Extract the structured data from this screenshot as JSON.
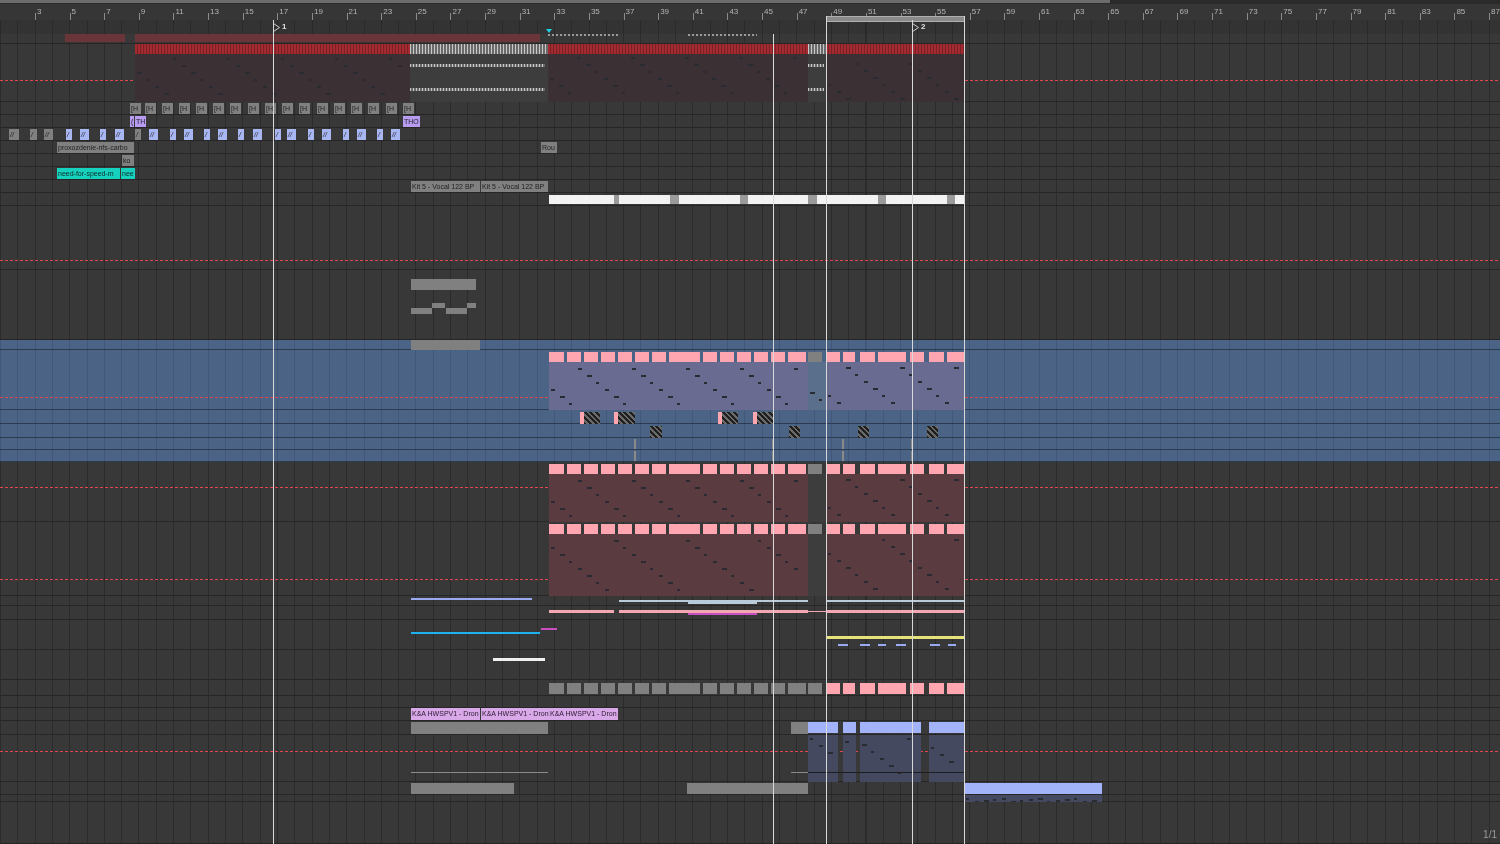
{
  "ruler": {
    "bar_labels": [
      "3",
      "5",
      "7",
      "9",
      "11",
      "13",
      "15",
      "17",
      "19",
      "21",
      "23",
      "25",
      "27",
      "29",
      "31",
      "33",
      "35",
      "37",
      "39",
      "41",
      "43",
      "45",
      "47",
      "49",
      "51",
      "53",
      "55",
      "57",
      "59",
      "61",
      "63",
      "65",
      "67",
      "69",
      "71",
      "73",
      "75",
      "77",
      "79",
      "81",
      "83",
      "85",
      "87"
    ]
  },
  "locators": [
    {
      "label": "1"
    },
    {
      "label": "2"
    }
  ],
  "tracks": [
    {
      "selected": false
    },
    {
      "selected": false
    },
    {
      "selected": false,
      "clips": [
        {
          "label": "[H"
        },
        {
          "label": "[H"
        },
        {
          "label": "[H"
        },
        {
          "label": "[H"
        },
        {
          "label": "[H"
        },
        {
          "label": "[H"
        },
        {
          "label": "[H"
        },
        {
          "label": "[H"
        },
        {
          "label": "[H"
        },
        {
          "label": "[H"
        },
        {
          "label": "[H"
        },
        {
          "label": "[H"
        },
        {
          "label": "[H"
        },
        {
          "label": "[H"
        },
        {
          "label": "[H"
        },
        {
          "label": "[H"
        },
        {
          "label": "[H"
        }
      ]
    },
    {
      "selected": false,
      "clips": [
        {
          "label": "("
        },
        {
          "label": "TH"
        },
        {
          "label": "THO"
        }
      ]
    },
    {
      "selected": false,
      "clips": [
        {
          "label": "//"
        },
        {
          "label": "/"
        },
        {
          "label": "//"
        },
        {
          "label": "/"
        },
        {
          "label": "//"
        },
        {
          "label": "/"
        },
        {
          "label": "//"
        },
        {
          "label": "/"
        },
        {
          "label": "//"
        },
        {
          "label": "/"
        },
        {
          "label": "//"
        },
        {
          "label": "/"
        },
        {
          "label": "//"
        },
        {
          "label": "/"
        },
        {
          "label": "//"
        },
        {
          "label": "/"
        },
        {
          "label": "//"
        },
        {
          "label": "/"
        },
        {
          "label": "//"
        },
        {
          "label": "/"
        },
        {
          "label": "//"
        },
        {
          "label": "/"
        },
        {
          "label": "//"
        }
      ]
    },
    {
      "selected": false,
      "clips": [
        {
          "label": "proxozdenie-nfs-carbo"
        },
        {
          "label": "Rou"
        }
      ]
    },
    {
      "selected": false,
      "clips": [
        {
          "label": "ko"
        }
      ]
    },
    {
      "selected": false,
      "clips": [
        {
          "label": "need-for-speed-m"
        },
        {
          "label": "nee"
        }
      ]
    },
    {
      "selected": false,
      "clips": [
        {
          "label": "Kit 5 - Vocal 122 BP"
        },
        {
          "label": "Kit 5 - Vocal 122 BP"
        }
      ]
    },
    {
      "selected": false
    },
    {
      "selected": false
    },
    {
      "selected": false
    },
    {
      "selected": true
    },
    {
      "selected": true
    },
    {
      "selected": true
    },
    {
      "selected": true
    },
    {
      "selected": true
    },
    {
      "selected": true
    },
    {
      "selected": false
    },
    {
      "selected": false
    },
    {
      "selected": false
    },
    {
      "selected": false
    },
    {
      "selected": false
    },
    {
      "selected": false
    },
    {
      "selected": false
    },
    {
      "selected": false
    },
    {
      "selected": false,
      "clips": [
        {
          "label": "K&A HWSPV1 - Dron"
        },
        {
          "label": "K&A HWSPV1 - Dron"
        },
        {
          "label": "K&A HWSPV1 - Dron"
        }
      ]
    },
    {
      "selected": false
    },
    {
      "selected": false
    },
    {
      "selected": false
    },
    {
      "selected": false
    },
    {
      "selected": false
    }
  ],
  "page_indicator": "1/1"
}
